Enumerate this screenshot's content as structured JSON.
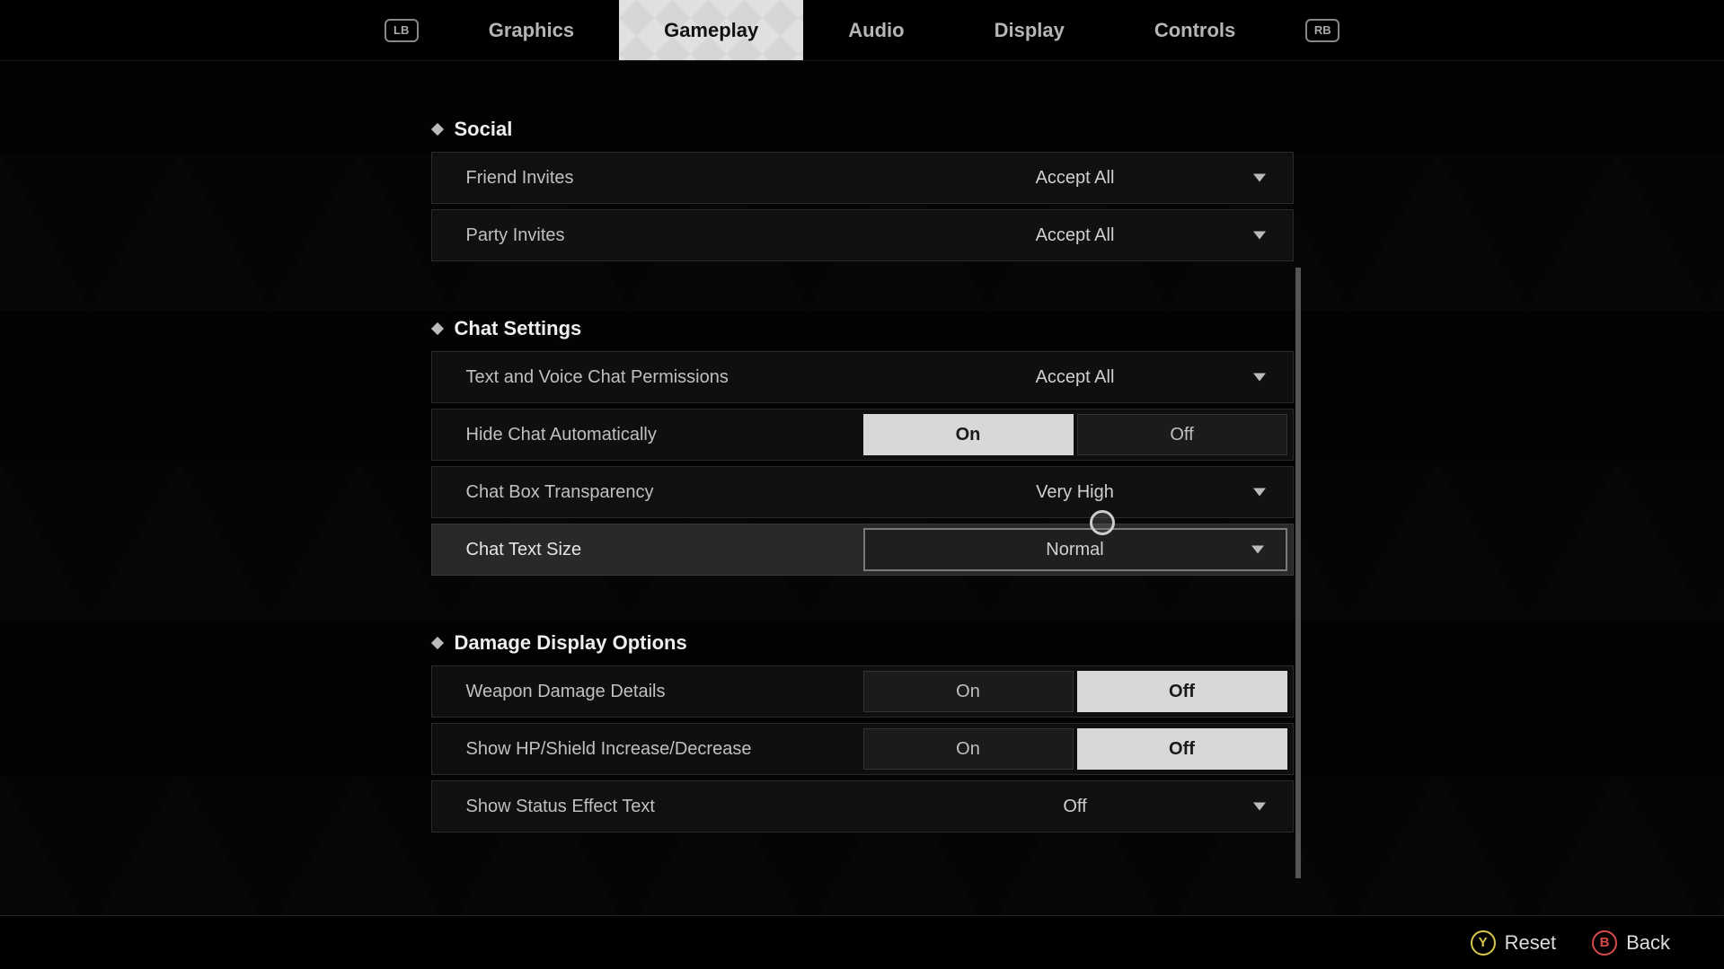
{
  "nav": {
    "bumper_left": "LB",
    "bumper_right": "RB",
    "tabs": {
      "graphics": "Graphics",
      "gameplay": "Gameplay",
      "audio": "Audio",
      "display": "Display",
      "controls": "Controls"
    },
    "active": "gameplay"
  },
  "sections": {
    "social": {
      "title": "Social",
      "friend_invites": {
        "label": "Friend Invites",
        "value": "Accept All"
      },
      "party_invites": {
        "label": "Party Invites",
        "value": "Accept All"
      }
    },
    "chat": {
      "title": "Chat Settings",
      "permissions": {
        "label": "Text and Voice Chat Permissions",
        "value": "Accept All"
      },
      "hide_auto": {
        "label": "Hide Chat Automatically",
        "on": "On",
        "off": "Off",
        "selected": "On"
      },
      "transparency": {
        "label": "Chat Box Transparency",
        "value": "Very High"
      },
      "text_size": {
        "label": "Chat Text Size",
        "value": "Normal"
      }
    },
    "damage": {
      "title": "Damage Display Options",
      "weapon_details": {
        "label": "Weapon Damage Details",
        "on": "On",
        "off": "Off",
        "selected": "Off"
      },
      "hp_shield": {
        "label": "Show HP/Shield Increase/Decrease",
        "on": "On",
        "off": "Off",
        "selected": "Off"
      },
      "status_text": {
        "label": "Show Status Effect Text",
        "value": "Off"
      }
    }
  },
  "footer": {
    "reset": {
      "glyph": "Y",
      "label": "Reset"
    },
    "back": {
      "glyph": "B",
      "label": "Back"
    }
  }
}
